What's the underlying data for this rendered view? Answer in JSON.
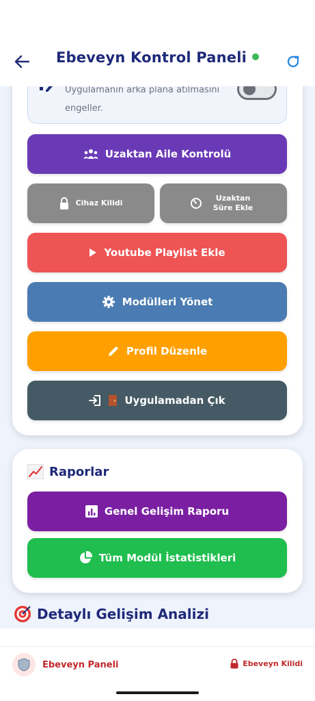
{
  "header": {
    "title": "Ebeveyn Kontrol Paneli"
  },
  "main_card": {
    "toggle": {
      "text": "Uygulamanın arka plana atılmasını engeller."
    },
    "buttons": {
      "remote_family_control": "Uzaktan Aile Kontrolü",
      "device_lock": "Cihaz Kilidi",
      "remote_add_time": "Uzaktan Süre Ekle",
      "youtube_playlist": "Youtube Playlist Ekle",
      "manage_modules": "Modülleri Yönet",
      "edit_profile": "Profil Düzenle",
      "exit_app": "Uygulamadan Çık"
    }
  },
  "reports": {
    "title": "Raporlar",
    "general_report": "Genel Gelişim Raporu",
    "module_stats": "Tüm Modül İstatistikleri"
  },
  "analysis": {
    "title": "Detaylı Gelişim Analizi"
  },
  "bottom_bar": {
    "panel_label": "Ebeveyn Paneli",
    "lock_label": "Ebeveyn Kilidi"
  },
  "colors": {
    "purple_button": "#6a3ab6",
    "gray_button": "#8a8a8a",
    "red_button": "#ee5454",
    "blue_button": "#4a7bb2",
    "orange_button": "#ffa000",
    "dark_button": "#455a64",
    "report_purple": "#7b1fa2",
    "report_green": "#1fbe4e",
    "title_navy": "#1f2a7a"
  }
}
